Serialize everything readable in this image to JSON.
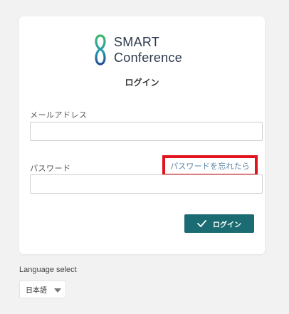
{
  "brand": {
    "line1": "SMART",
    "line2": "Conference"
  },
  "login_form": {
    "title": "ログイン",
    "email_label": "メールアドレス",
    "email_value": "",
    "password_label": "パスワード",
    "password_value": "",
    "forgot_link": "パスワードを忘れたら",
    "submit_label": "ログイン"
  },
  "language": {
    "label": "Language select",
    "selected": "日本語"
  },
  "colors": {
    "primary_button": "#1a6b72",
    "highlight_box": "#e0141e",
    "link": "#5a84a6"
  },
  "icons": {
    "brand_logo": "infinity-loop-logo",
    "submit": "checkmark-icon",
    "dropdown": "chevron-down-icon"
  }
}
